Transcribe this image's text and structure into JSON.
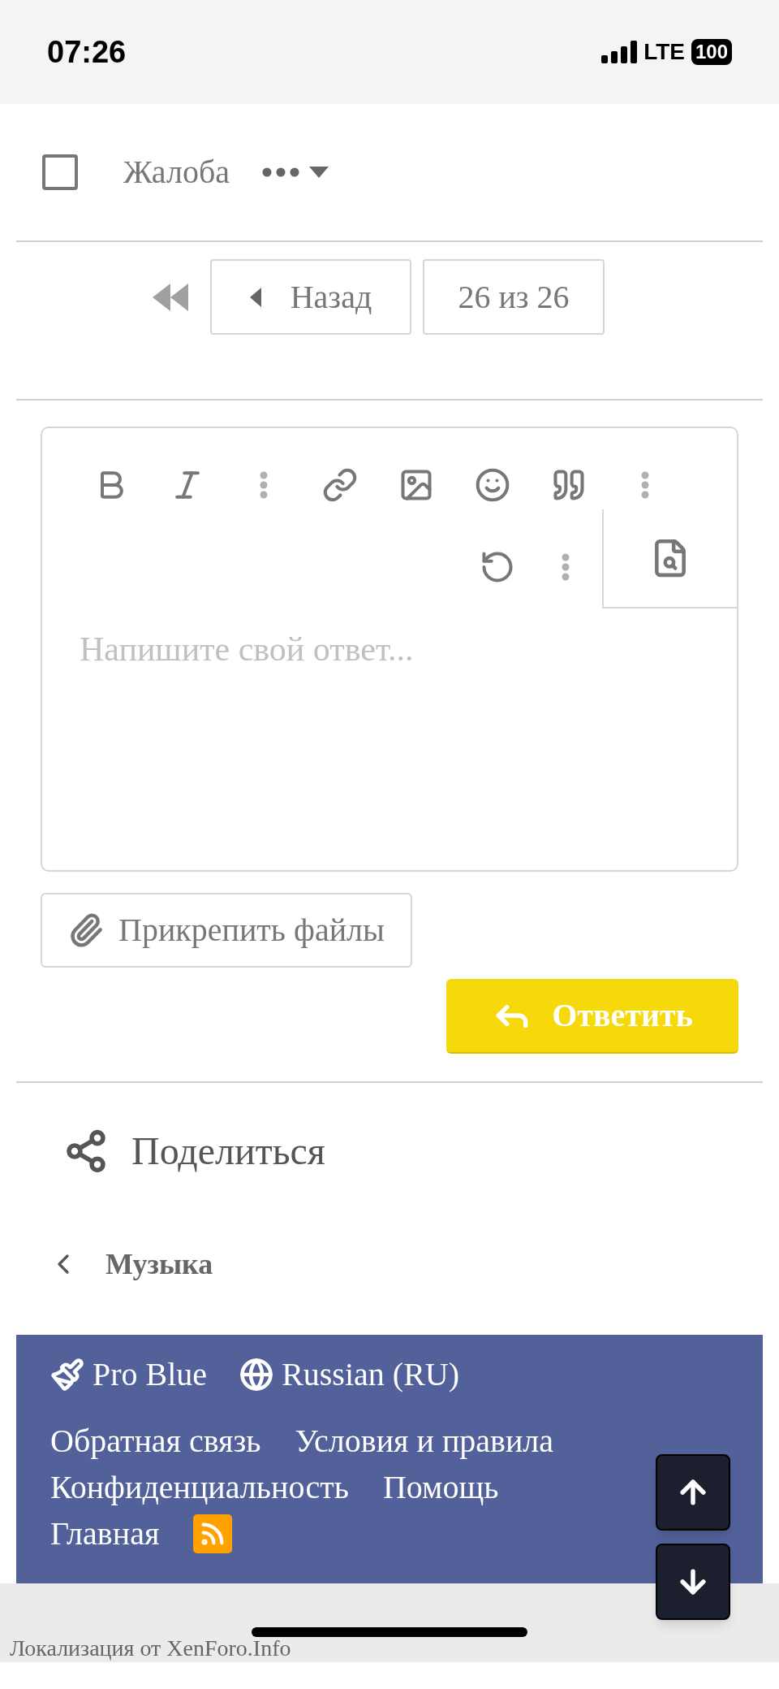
{
  "status_bar": {
    "time": "07:26",
    "network": "LTE",
    "battery": "100"
  },
  "post_actions": {
    "select_checked": false,
    "report": "Жалоба"
  },
  "pagination": {
    "prev": "Назад",
    "current": "26 из 26"
  },
  "editor": {
    "placeholder": "Напишите свой ответ..."
  },
  "attach": "Прикрепить файлы",
  "reply": "Ответить",
  "share": "Поделиться",
  "breadcrumb": "Музыка",
  "footer": {
    "style": "Pro Blue",
    "language": "Russian (RU)",
    "links": [
      {
        "kind": "text",
        "label": "Обратная связь"
      },
      {
        "kind": "text",
        "label": "Условия и правила"
      },
      {
        "kind": "text",
        "label": "Конфиденциальность"
      },
      {
        "kind": "text",
        "label": "Помощь"
      },
      {
        "kind": "text",
        "label": "Главная"
      },
      {
        "kind": "rss"
      }
    ]
  },
  "credit": "Локализация от XenForo.Info"
}
